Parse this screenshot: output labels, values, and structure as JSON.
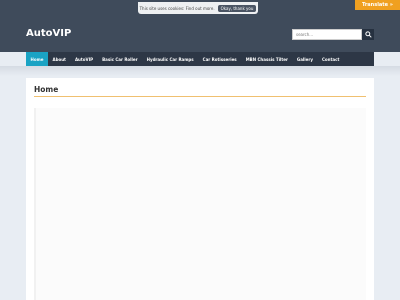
{
  "cookie": {
    "text": "This site uses cookies: Find out more.",
    "accept_label": "Okay, thank you"
  },
  "translate": {
    "label": "Translate »"
  },
  "site": {
    "title": "AutoVIP"
  },
  "search": {
    "placeholder": "search..."
  },
  "nav": {
    "items": [
      {
        "label": "Home"
      },
      {
        "label": "About"
      },
      {
        "label": "AutoVIP"
      },
      {
        "label": "Basic Car Roller"
      },
      {
        "label": "Hydraulic Car Ramps"
      },
      {
        "label": "Car Rotisseries"
      },
      {
        "label": "MBN Chassis Tilter"
      },
      {
        "label": "Gallery"
      },
      {
        "label": "Contact"
      }
    ],
    "active_index": 0
  },
  "page": {
    "title": "Home"
  },
  "colors": {
    "header_bg": "#3f4b5b",
    "nav_bg": "#2d3746",
    "nav_active": "#1aa3c4",
    "translate_bg": "#f0a020",
    "title_rule": "#f0c070",
    "page_bg": "#e8edf3"
  },
  "icons": {
    "search": "magnifier-icon"
  }
}
